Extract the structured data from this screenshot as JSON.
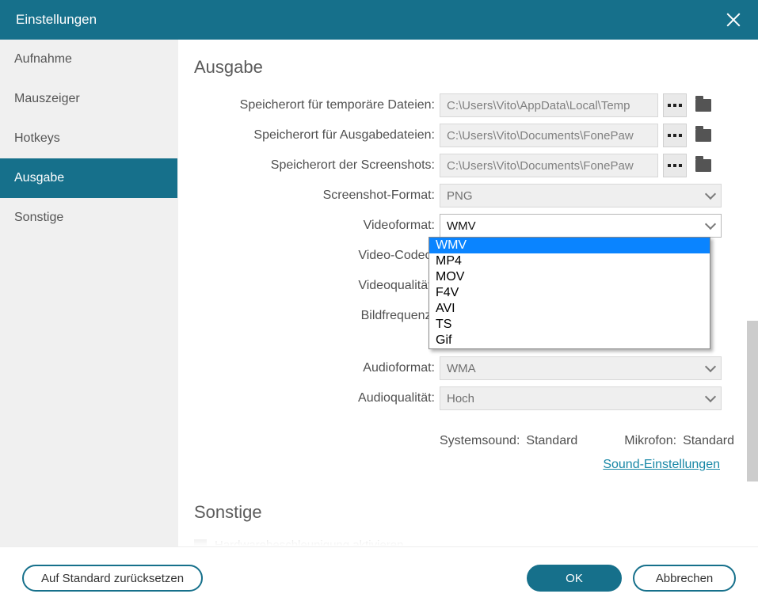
{
  "window": {
    "title": "Einstellungen"
  },
  "sidebar": {
    "items": [
      {
        "label": "Aufnahme"
      },
      {
        "label": "Mauszeiger"
      },
      {
        "label": "Hotkeys"
      },
      {
        "label": "Ausgabe"
      },
      {
        "label": "Sonstige"
      }
    ],
    "active_index": 3
  },
  "section": {
    "output_heading": "Ausgabe",
    "other_heading": "Sonstige"
  },
  "labels": {
    "temp_path": "Speicherort für temporäre Dateien:",
    "output_path": "Speicherort für Ausgabedateien:",
    "screenshot_path": "Speicherort der Screenshots:",
    "screenshot_format": "Screenshot-Format:",
    "video_format": "Videoformat:",
    "video_codec": "Video-Codec:",
    "video_quality": "Videoqualität:",
    "framerate": "Bildfrequenz:",
    "audio_format": "Audioformat:",
    "audio_quality": "Audioqualität:"
  },
  "values": {
    "temp_path": "C:\\Users\\Vito\\AppData\\Local\\Temp",
    "output_path": "C:\\Users\\Vito\\Documents\\FonePaw",
    "screenshot_path": "C:\\Users\\Vito\\Documents\\FonePaw",
    "screenshot_format": "PNG",
    "video_format": "WMV",
    "audio_format": "WMA",
    "audio_quality": "Hoch"
  },
  "video_format_options": [
    "WMV",
    "MP4",
    "MOV",
    "F4V",
    "AVI",
    "TS",
    "Gif"
  ],
  "status": {
    "system_label": "Systemsound:",
    "system_value": "Standard",
    "mic_label": "Mikrofon:",
    "mic_value": "Standard"
  },
  "links": {
    "sound_settings": "Sound-Einstellungen"
  },
  "other": {
    "hw_accel": "Hardwarebeschleunigung aktivieren"
  },
  "footer": {
    "reset": "Auf Standard zurücksetzen",
    "ok": "OK",
    "cancel": "Abbrechen"
  }
}
